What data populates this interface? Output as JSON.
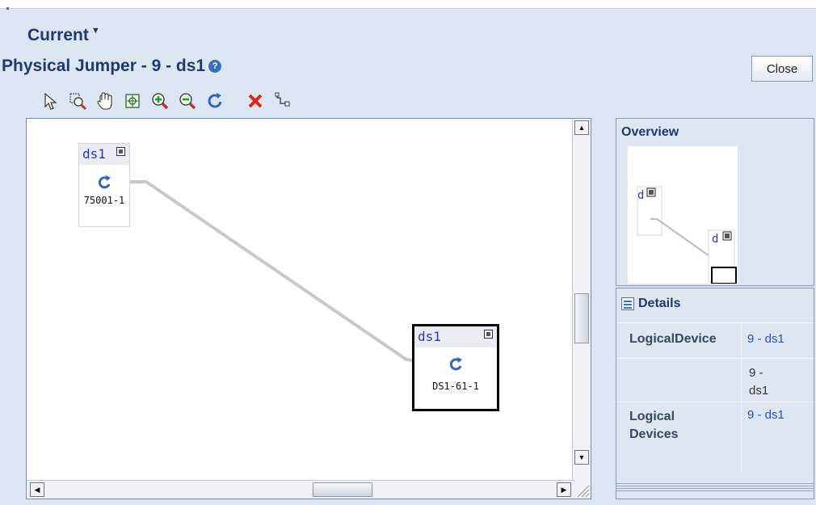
{
  "header": {
    "current_label": "Current",
    "current_caret": "▼",
    "title": "Physical Jumper - 9 - ds1",
    "help_glyph": "?",
    "close_label": "Close"
  },
  "toolbar": {
    "tools": [
      "select-icon",
      "zoom-select-icon",
      "pan-hand-icon",
      "fit-to-window-icon",
      "zoom-in-icon",
      "zoom-out-icon",
      "refresh-icon",
      "delete-icon",
      "connector-icon"
    ]
  },
  "diagram": {
    "nodes": [
      {
        "name": "ds1",
        "label": "75001-1"
      },
      {
        "name": "ds1",
        "label": "DS1-61-1"
      }
    ],
    "colors": {
      "node_name": "#2a35c4",
      "link": "#c8c8c8",
      "selected_border": "#000000"
    }
  },
  "overview": {
    "title": "Overview",
    "mini_label": "d"
  },
  "details": {
    "title": "Details",
    "rows": [
      {
        "label": "LogicalDevice",
        "value": "9 - ds1"
      },
      {
        "label": "",
        "value": "9 -\nds1"
      },
      {
        "label": "Logical\nDevices",
        "value": "9 - ds1"
      }
    ]
  }
}
